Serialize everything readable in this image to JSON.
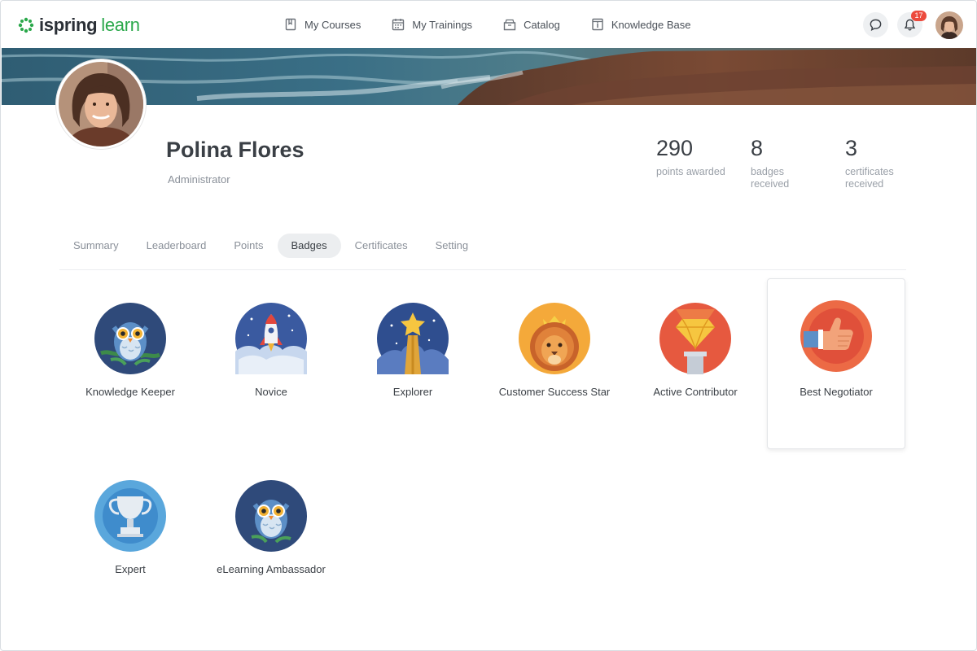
{
  "app": {
    "logo_word1": "ispring",
    "logo_word2": "learn"
  },
  "nav": [
    {
      "label": "My Courses"
    },
    {
      "label": "My Trainings"
    },
    {
      "label": "Catalog"
    },
    {
      "label": "Knowledge Base"
    }
  ],
  "header": {
    "notifications_count": "17"
  },
  "profile": {
    "name": "Polina Flores",
    "role": "Administrator",
    "stats": [
      {
        "value": "290",
        "label": "points awarded"
      },
      {
        "value": "8",
        "label": "badges received"
      },
      {
        "value": "3",
        "label": "certificates received"
      }
    ]
  },
  "tabs": [
    {
      "label": "Summary",
      "active": false
    },
    {
      "label": "Leaderboard",
      "active": false
    },
    {
      "label": "Points",
      "active": false
    },
    {
      "label": "Badges",
      "active": true
    },
    {
      "label": "Certificates",
      "active": false
    },
    {
      "label": "Setting",
      "active": false
    }
  ],
  "badges": [
    {
      "label": "Knowledge Keeper",
      "icon": "owl-icon"
    },
    {
      "label": "Novice",
      "icon": "rocket-icon"
    },
    {
      "label": "Explorer",
      "icon": "star-icon"
    },
    {
      "label": "Customer Success Star",
      "icon": "lion-icon"
    },
    {
      "label": "Active Contributor",
      "icon": "diamond-icon"
    },
    {
      "label": "Best Negotiator",
      "icon": "thumbs-up-icon"
    },
    {
      "label": "Expert",
      "icon": "trophy-icon"
    },
    {
      "label": "eLearning Ambassador",
      "icon": "owl-icon"
    }
  ],
  "colors": {
    "brand_green": "#2aa84a",
    "notification_red": "#ec4a3d",
    "active_tab_bg": "#eceef0"
  }
}
